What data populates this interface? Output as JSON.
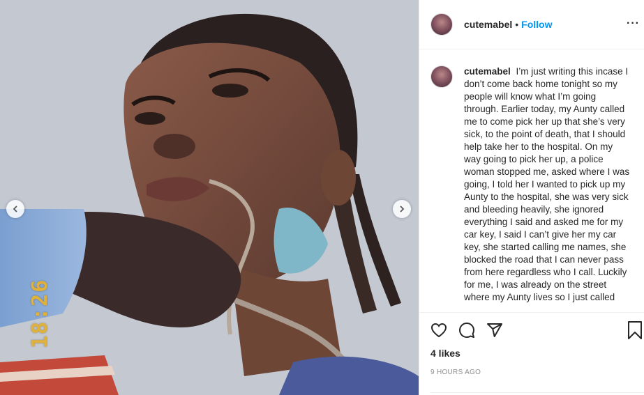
{
  "post": {
    "username": "cutemabel",
    "separator": "•",
    "follow_label": "Follow",
    "more_label": "···",
    "caption": "I’m just writing this incase I don’t come back home tonight so my people will know what I’m going through. Earlier today, my Aunty called me to come pick her up that she’s very sick, to the point of death, that I should help take her to the hospital. On my way going to pick her up, a police woman stopped me, asked where I was going, I told her I wanted to pick up my Aunty to the hospital, she was very sick and bleeding heavily, she ignored everything I said and asked me for my car key, I said I can’t give her my car key, she started calling me names, she blocked the road that I can never pass from here regardless who I call. Luckily for me, I was already on the street where my Aunty lives so I just called",
    "likes": "4 likes",
    "time_ago": "9 HOURS AGO"
  },
  "media": {
    "timestamp_overlay": "18:26"
  },
  "icons": {
    "prev": "chevron-left-icon",
    "next": "chevron-right-icon",
    "like": "heart-icon",
    "comment": "comment-icon",
    "share": "paper-plane-icon",
    "save": "bookmark-icon"
  },
  "colors": {
    "follow": "#0095f6",
    "text": "#262626",
    "muted": "#8e8e8e",
    "border": "#efefef"
  }
}
